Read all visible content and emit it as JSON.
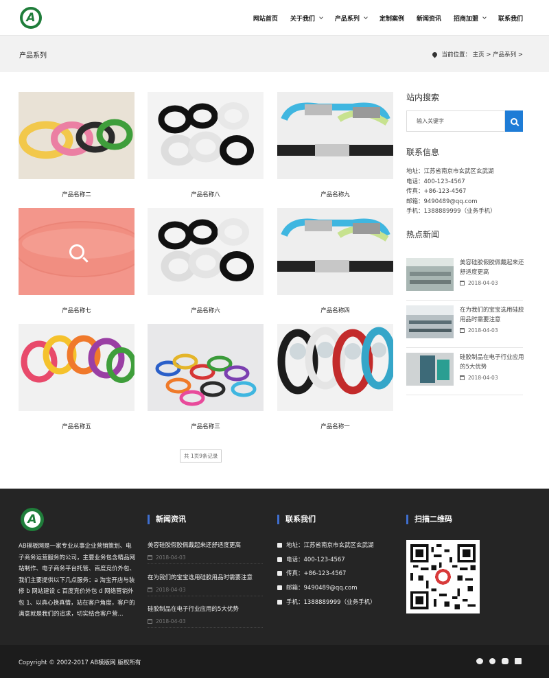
{
  "header": {
    "logo_letter": "A",
    "nav": [
      {
        "label": "网站首页",
        "dropdown": false
      },
      {
        "label": "关于我们",
        "dropdown": true
      },
      {
        "label": "产品系列",
        "dropdown": true
      },
      {
        "label": "定制案例",
        "dropdown": false
      },
      {
        "label": "新闻资讯",
        "dropdown": false
      },
      {
        "label": "招商加盟",
        "dropdown": true
      },
      {
        "label": "联系我们",
        "dropdown": false
      }
    ]
  },
  "banner": {
    "title": "产品系列",
    "breadcrumb": "当前位置： 主页 > 产品系列 >"
  },
  "products": [
    {
      "name": "产品名称二",
      "image": "colorful-wristbands"
    },
    {
      "name": "产品名称八",
      "image": "black-white-rings"
    },
    {
      "name": "产品名称九",
      "image": "blue-green-bands"
    },
    {
      "name": "产品名称七",
      "image": "pink-bestie-band"
    },
    {
      "name": "产品名称六",
      "image": "black-white-rings"
    },
    {
      "name": "产品名称四",
      "image": "blue-green-bands"
    },
    {
      "name": "产品名称五",
      "image": "rainbow-bands"
    },
    {
      "name": "产品名称三",
      "image": "mixed-pile-bands"
    },
    {
      "name": "产品名称一",
      "image": "power-balance-bands"
    }
  ],
  "pager": "共 1页9条记录",
  "sidebar": {
    "search_title": "站内搜索",
    "search_placeholder": "输入关键字",
    "contact_title": "联系信息",
    "contact_lines": [
      "地址：江苏省南京市玄武区玄武湖",
      "电话：400-123-4567",
      "传真：+86-123-4567",
      "邮箱：9490489@qq.com",
      "手机：1388889999（业务手机）"
    ],
    "news_title": "热点新闻",
    "news": [
      {
        "title": "美容硅胶假胶佩戴起来还舒适度更高",
        "date": "2018-04-03"
      },
      {
        "title": "在为我们的宝宝选用硅胶用品时需要注意",
        "date": "2018-04-03"
      },
      {
        "title": "硅胶制品在电子行业应用的5大优势",
        "date": "2018-04-03"
      }
    ]
  },
  "footer": {
    "about": "AB模板网是一家专业从事企业营销策划、电子商务运营服务的公司，主要业务包含精品网站制作、电子商务平台托管、百度竞价外包、 我们主要提供以下几点服务：a 淘宝开店与装修 b 网站建设 c 百度竞价外包 d 网络营销外包 1、以真心换真情，站在客户角度，客户的满意就是我们的追求，切实结合客户营...",
    "news_heading": "新闻资讯",
    "news": [
      {
        "title": "美容硅胶假胶佩戴起来还舒适度更高",
        "date": "2018-04-03"
      },
      {
        "title": "在为我们的宝宝选用硅胶用品时需要注意",
        "date": "2018-04-03"
      },
      {
        "title": "硅胶制品在电子行业应用的5大优势",
        "date": "2018-04-03"
      }
    ],
    "contact_heading": "联系我们",
    "contact": [
      {
        "text": "地址：江苏省南京市玄武区玄武湖",
        "icon": "map-pin-icon"
      },
      {
        "text": "电话：400-123-4567",
        "icon": "phone-icon"
      },
      {
        "text": "传真：+86-123-4567",
        "icon": "fax-icon"
      },
      {
        "text": "邮箱：9490489@qq.com",
        "icon": "mail-icon"
      },
      {
        "text": "手机：1388889999（业务手机）",
        "icon": "mobile-icon"
      }
    ],
    "qr_heading": "扫描二维码",
    "copyright": "Copyright © 2002-2017 AB模版网 版权所有",
    "social": [
      "weibo-icon",
      "pinterest-icon",
      "qq-icon",
      "mail-icon"
    ]
  },
  "colors": {
    "accent_blue": "#1e7cd6",
    "brand_green": "#1f7d3a",
    "footer_bg": "#252525",
    "footer_heading_bar": "#3f6fd0"
  }
}
